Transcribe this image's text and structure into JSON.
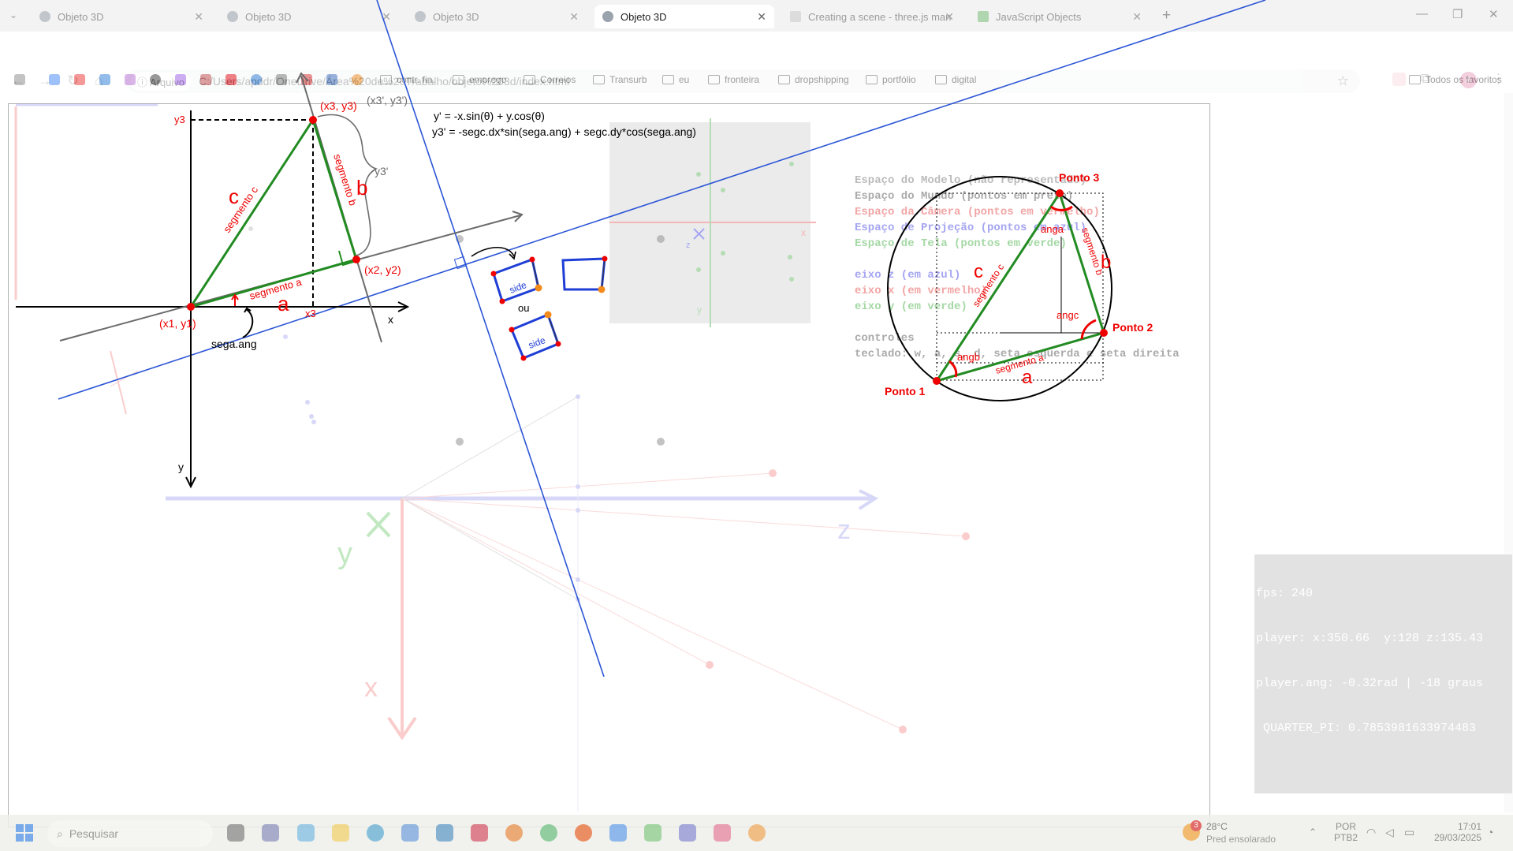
{
  "browser": {
    "tabs": [
      {
        "title": "Objeto 3D",
        "active": false
      },
      {
        "title": "Objeto 3D",
        "active": false
      },
      {
        "title": "Objeto 3D",
        "active": false
      },
      {
        "title": "Objeto 3D",
        "active": true
      },
      {
        "title": "Creating a scene - three.js man",
        "active": false
      },
      {
        "title": "JavaScript Objects",
        "active": false
      }
    ],
    "new_tab": "+",
    "address_chip": "Arquivo",
    "url": "C:/Users/apddr/OneDrive/Área%20de%20Trabalho/objeto%203d/index.html",
    "bookmarks": [
      "contr. fin.",
      "emprego",
      "Correios",
      "Transurb",
      "eu",
      "fronteira",
      "dropshipping",
      "portfólio",
      "digital"
    ],
    "all_bookmarks": "Todos os favoritos",
    "profile_initial": "A"
  },
  "formulas": {
    "line1": "y'  =  -x.sin(θ) + y.cos(θ)",
    "line2": "y3' = -segc.dx*sin(sega.ang) + segc.dy*cos(sega.ang)"
  },
  "diagram_left": {
    "point1": "(x1, y1)",
    "point2": "(x2, y2)",
    "point3": "(x3, y3)",
    "point3p": "(x3', y3')",
    "y3": "y3",
    "y3p": "y3'",
    "x3": "x3",
    "axis_x": "x",
    "axis_y": "y",
    "seg_a": "segmento a",
    "seg_b": "segmento b",
    "seg_c": "segmento c",
    "letter_a": "a",
    "letter_b": "b",
    "letter_c": "c",
    "sega_ang": "sega.ang",
    "side1": "side",
    "side2": "side",
    "ou": "ou"
  },
  "legend": {
    "lines": [
      {
        "text": "Espaço do Modelo (não representado)",
        "color": "#bbbbbb"
      },
      {
        "text": "Espaço do Mundo (pontos em preto)",
        "color": "#aaaaaa"
      },
      {
        "text": "Espaço da Câmera (pontos em vermelho)",
        "color": "#f2a5a5"
      },
      {
        "text": "Espaço de Projeção (pontos em azul)",
        "color": "#a5a5f2"
      },
      {
        "text": "Espaço de Tela (pontos em verde)",
        "color": "#a5d8a5"
      },
      {
        "text": "",
        "color": "#ffffff"
      },
      {
        "text": "eixo z (em azul)",
        "color": "#a5a5f2"
      },
      {
        "text": "eixo x (em vermelho)",
        "color": "#f2a5a5"
      },
      {
        "text": "eixo y (em verde)",
        "color": "#a5d8a5"
      },
      {
        "text": "",
        "color": "#ffffff"
      },
      {
        "text": "controles",
        "color": "#aaaaaa"
      },
      {
        "text": "teclado: w, a, s, d, seta esquerda e seta direita",
        "color": "#aaaaaa"
      }
    ]
  },
  "circle_diagram": {
    "p1": "Ponto 1",
    "p2": "Ponto 2",
    "p3": "Ponto 3",
    "anga": "anga",
    "angb": "angb",
    "angc": "angc",
    "seg_a": "segmento a",
    "seg_b": "segmento b",
    "seg_c": "segmento c",
    "a": "a",
    "b": "b",
    "c": "c"
  },
  "world_axes": {
    "z": "z",
    "y": "y",
    "x": "x"
  },
  "mini_view": {
    "z": "z",
    "y": "y",
    "x": "x"
  },
  "hud": {
    "fps": "fps: 240",
    "player": "player: x:350.66  y:128 z:135.43",
    "ang": "player.ang: -0.32rad | -18 graus",
    "qpi": " QUARTER_PI: 0.7853981633974483"
  },
  "taskbar": {
    "search": "Pesquisar",
    "temp": "28°C",
    "weather": "Pred ensolarado",
    "lang": "POR",
    "kb": "PTB2",
    "time": "17:01",
    "date": "29/03/2025",
    "badge": "3"
  }
}
